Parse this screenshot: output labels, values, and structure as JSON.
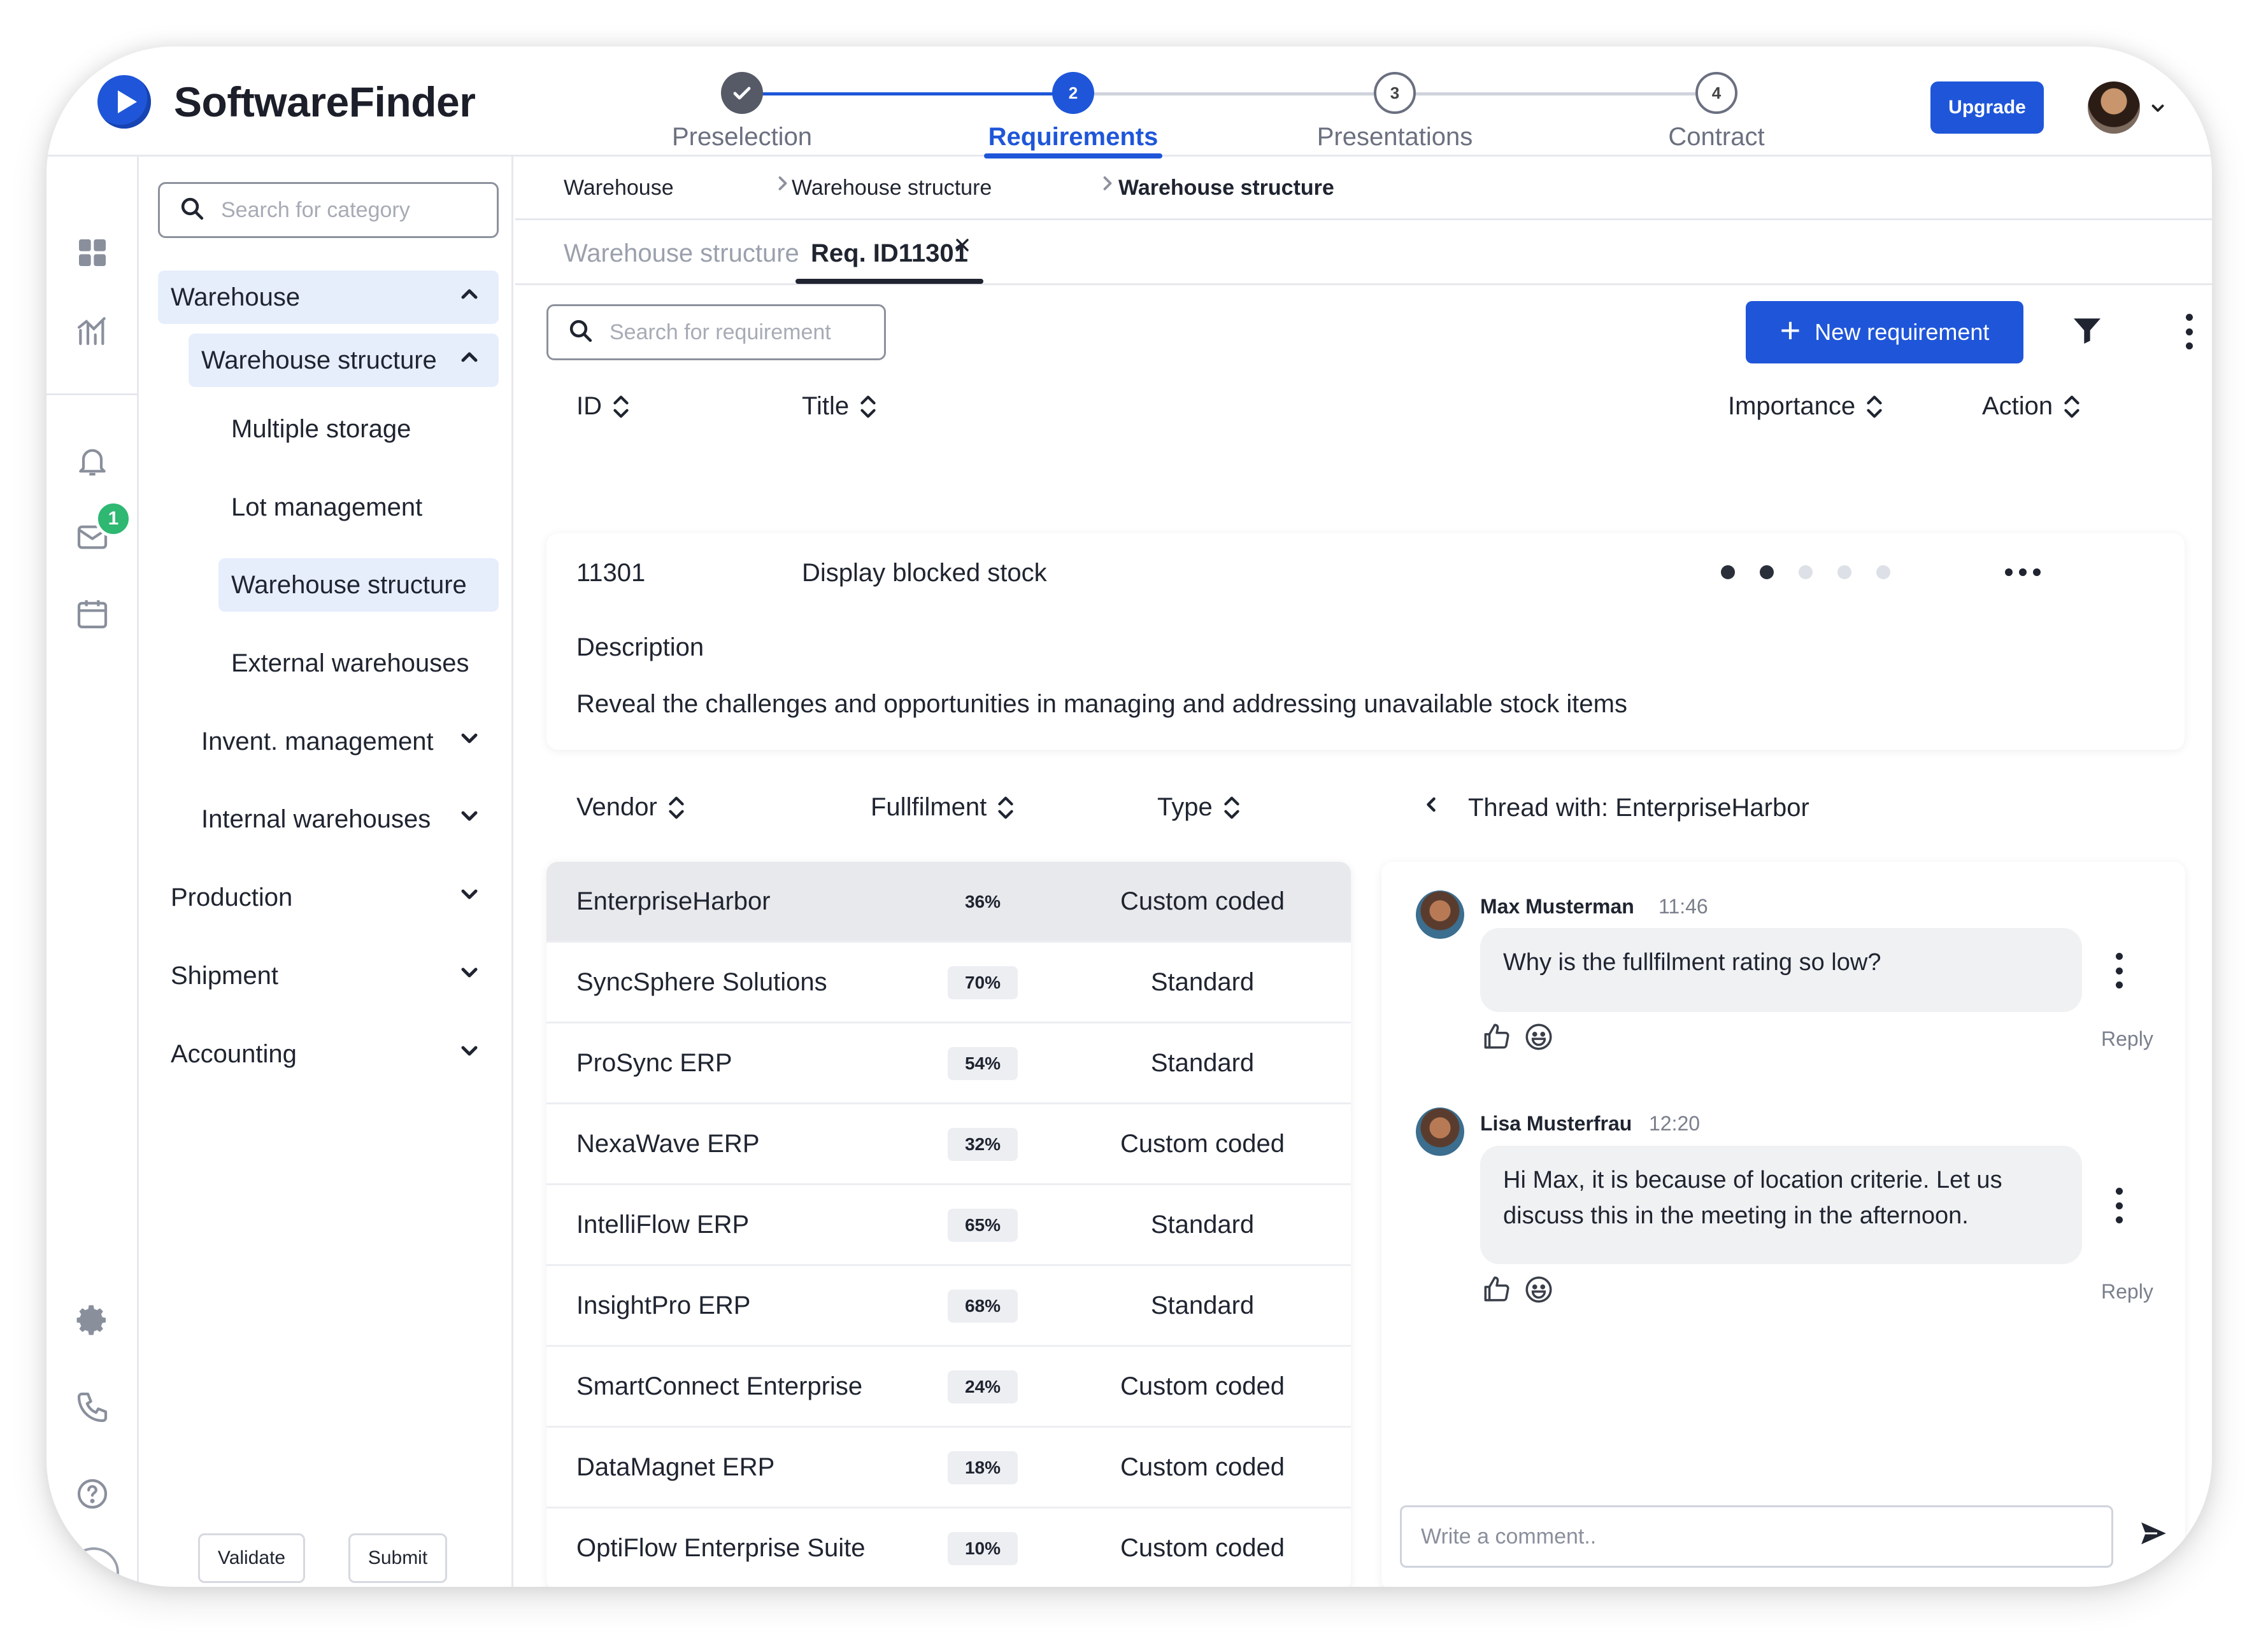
{
  "app": {
    "name": "SoftwareFinder",
    "upgrade_label": "Upgrade",
    "colors": {
      "accent": "#1f56d9",
      "success": "#2eb872",
      "text": "#1f2430",
      "muted": "#6b7080"
    }
  },
  "stepper": {
    "steps": [
      {
        "number": "",
        "label": "Preselection",
        "state": "done"
      },
      {
        "number": "2",
        "label": "Requirements",
        "state": "active"
      },
      {
        "number": "3",
        "label": "Presentations",
        "state": "todo"
      },
      {
        "number": "4",
        "label": "Contract",
        "state": "todo"
      }
    ]
  },
  "rail": {
    "icons": [
      "dashboard-icon",
      "analytics-icon",
      "bell-icon",
      "mail-icon",
      "calendar-icon",
      "settings-icon",
      "phone-icon",
      "help-icon",
      "expand-icon"
    ],
    "mail_badge": "1"
  },
  "sidebar": {
    "search_placeholder": "Search for category",
    "items": [
      {
        "label": "Warehouse",
        "expanded": true
      },
      {
        "label": "Warehouse structure",
        "expanded": true
      },
      {
        "label": "Multiple storage"
      },
      {
        "label": "Lot management"
      },
      {
        "label": "Warehouse structure",
        "selected": true
      },
      {
        "label": "External warehouses"
      },
      {
        "label": "Invent. management"
      },
      {
        "label": "Internal warehouses"
      },
      {
        "label": "Production"
      },
      {
        "label": "Shipment"
      },
      {
        "label": "Accounting"
      }
    ],
    "validate_label": "Validate",
    "submit_label": "Submit"
  },
  "breadcrumb": [
    "Warehouse",
    "Warehouse structure",
    "Warehouse structure"
  ],
  "tabs": [
    {
      "label": "Warehouse structure",
      "active": false
    },
    {
      "label": "Req. ID11301",
      "active": true,
      "closable": true
    }
  ],
  "toolbar": {
    "search_placeholder": "Search for requirement",
    "new_label": "New requirement"
  },
  "requirements": {
    "columns": {
      "id": "ID",
      "title": "Title",
      "importance": "Importance",
      "action": "Action"
    },
    "row": {
      "id": "11301",
      "title": "Display blocked stock",
      "importance": 2,
      "importance_max": 5,
      "description_label": "Description",
      "description": "Reveal the challenges and opportunities in managing and addressing unavailable stock items"
    }
  },
  "vendors": {
    "columns": {
      "vendor": "Vendor",
      "fulfillment": "Fullfilment",
      "type": "Type"
    },
    "rows": [
      {
        "name": "EnterpriseHarbor",
        "fulfillment": "36%",
        "type": "Custom coded",
        "selected": true
      },
      {
        "name": "SyncSphere Solutions",
        "fulfillment": "70%",
        "type": "Standard"
      },
      {
        "name": "ProSync ERP",
        "fulfillment": "54%",
        "type": "Standard"
      },
      {
        "name": "NexaWave ERP",
        "fulfillment": "32%",
        "type": "Custom coded"
      },
      {
        "name": "IntelliFlow ERP",
        "fulfillment": "65%",
        "type": "Standard"
      },
      {
        "name": "InsightPro ERP",
        "fulfillment": "68%",
        "type": "Standard"
      },
      {
        "name": "SmartConnect Enterprise",
        "fulfillment": "24%",
        "type": "Custom coded"
      },
      {
        "name": "DataMagnet ERP",
        "fulfillment": "18%",
        "type": "Custom coded"
      },
      {
        "name": "OptiFlow Enterprise Suite",
        "fulfillment": "10%",
        "type": "Custom coded"
      }
    ]
  },
  "thread": {
    "title": "Thread with: EnterpriseHarbor",
    "messages": [
      {
        "author": "Max Musterman",
        "time": "11:46",
        "text": "Why is the fullfilment rating so low?",
        "reply_label": "Reply"
      },
      {
        "author": "Lisa Musterfrau",
        "time": "12:20",
        "text_line1": "Hi Max, it is because of location criterie. Let us",
        "text_line2": "discuss this in the meeting in the afternoon.",
        "reply_label": "Reply"
      }
    ],
    "comment_placeholder": "Write a comment.."
  }
}
